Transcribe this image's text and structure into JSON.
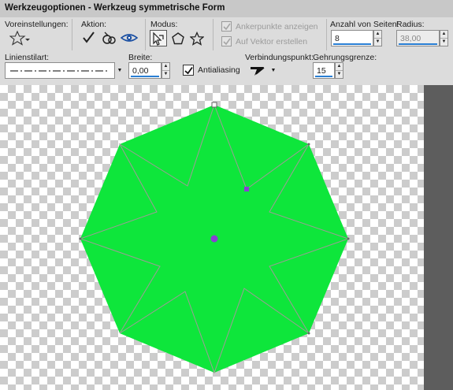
{
  "window": {
    "title": "Werkzeugoptionen - Werkzeug symmetrische Form"
  },
  "labels": {
    "presets": "Voreinstellungen:",
    "action": "Aktion:",
    "mode": "Modus:",
    "sides": "Anzahl von Seiten:",
    "radius": "Radius:",
    "line_style": "Linienstilart:",
    "width": "Breite:",
    "join": "Verbindungspunkt:",
    "miter": "Gehrungsgrenze:"
  },
  "checkboxes": {
    "anchors": {
      "label": "Ankerpunkte anzeigen",
      "checked": true,
      "enabled": false
    },
    "vector": {
      "label": "Auf Vektor erstellen",
      "checked": true,
      "enabled": false
    },
    "antialias": {
      "label": "Antialiasing",
      "checked": true,
      "enabled": true
    }
  },
  "fields": {
    "sides": "8",
    "radius": "38,00",
    "width": "0,00",
    "miter": "15"
  },
  "icons": {
    "preset": "star-preset-icon",
    "apply": "checkmark-icon",
    "reset": "reset-icon",
    "preview": "eye-icon",
    "mode_star": "arrow-cursor-icon",
    "mode_polygon": "pentagon-icon",
    "mode_star2": "star-icon",
    "join": "join-miter-icon",
    "spin_up": "▲",
    "spin_down": "▼",
    "dropdown": "▼"
  },
  "colors": {
    "shape_fill": "#0ee63b",
    "outline": "#a09a98",
    "anchor": "#8a3fd4"
  }
}
